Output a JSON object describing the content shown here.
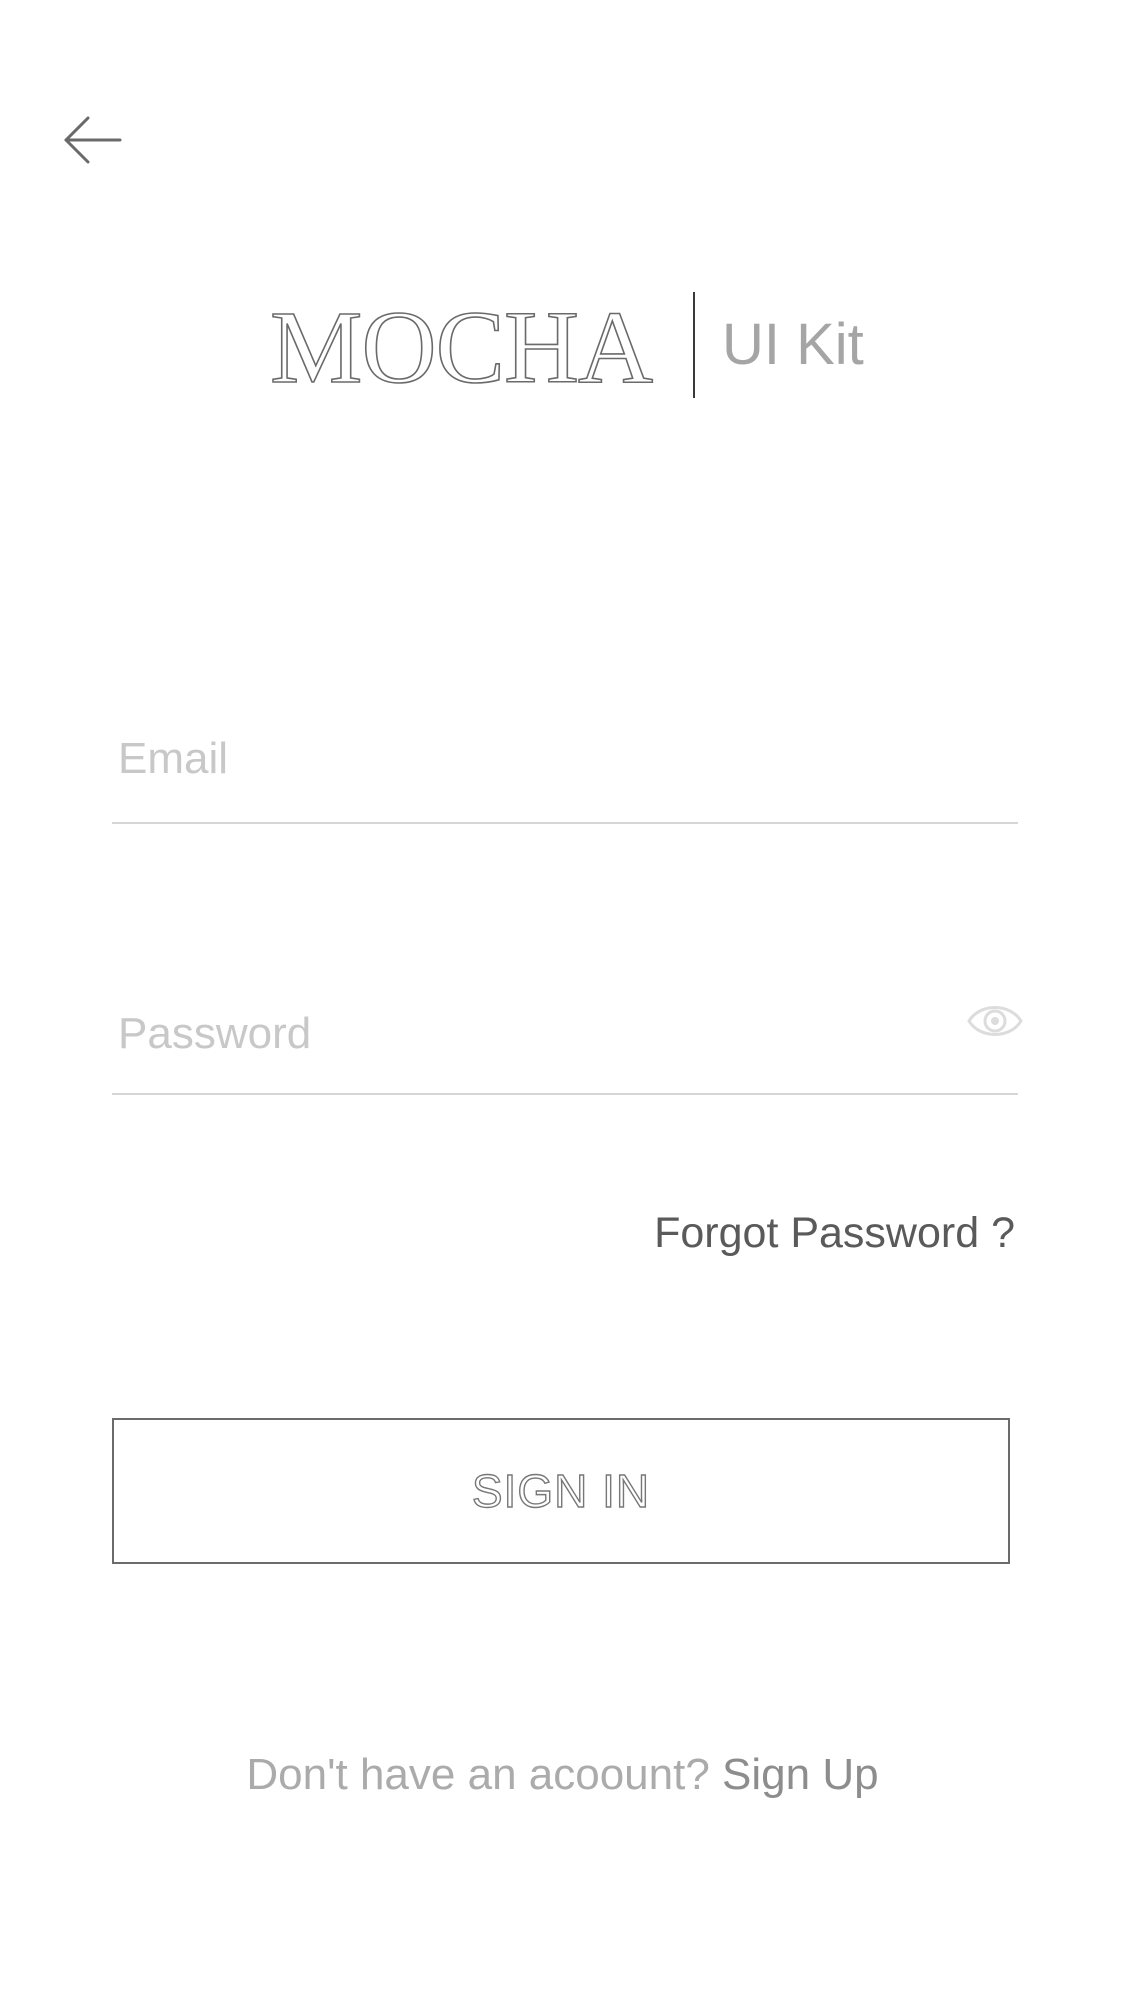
{
  "header": {
    "back_icon": "arrow-left-icon"
  },
  "logo": {
    "brand": "MOCHA",
    "subtitle": "UI Kit"
  },
  "form": {
    "email": {
      "placeholder": "Email",
      "value": ""
    },
    "password": {
      "placeholder": "Password",
      "value": "",
      "toggle_icon": "eye-icon"
    },
    "forgot_label": "Forgot Password ?",
    "submit_label": "SIGN IN"
  },
  "footer": {
    "prompt": "Don't have an acoount?",
    "link_label": "Sign Up"
  },
  "colors": {
    "background": "#ffffff",
    "text_primary": "#5c5c5c",
    "placeholder": "#c8c8c8",
    "divider": "#d6d6d6",
    "button_border": "#6b6b6b"
  }
}
